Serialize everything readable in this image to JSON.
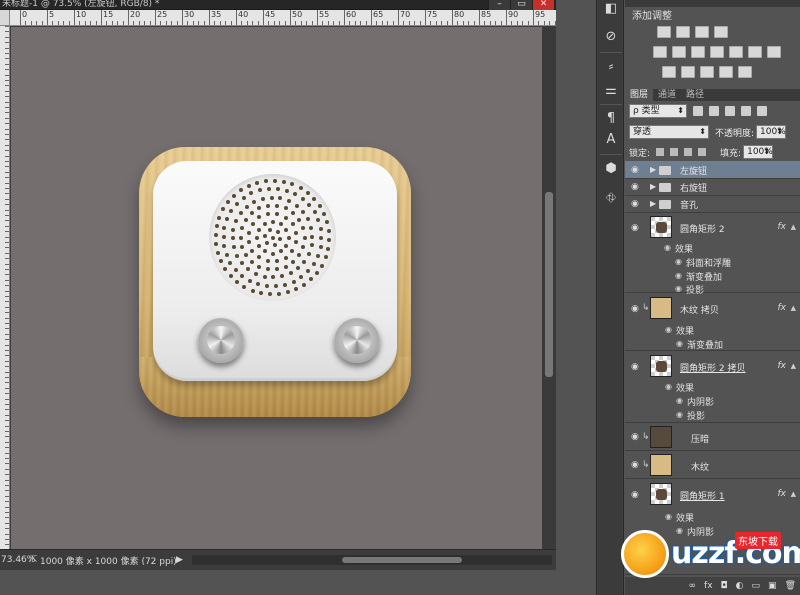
{
  "document": {
    "title": "未标题-1 @ 73.5% (左旋钮, RGB/8) *",
    "ruler_labels": [
      "0",
      "5",
      "10",
      "15",
      "20",
      "25",
      "30",
      "35",
      "40",
      "45",
      "50",
      "55",
      "60",
      "65",
      "70",
      "75",
      "80",
      "85",
      "90",
      "95"
    ],
    "window_buttons": [
      "–",
      "▭",
      "✕"
    ]
  },
  "status": {
    "zoom": "73.46%",
    "doc_size": "1000 像素 x 1000 像素 (72 ppi)",
    "arrow": "▶"
  },
  "adjustments": {
    "tabs_hidden": true,
    "title": "添加调整"
  },
  "layers_panel": {
    "tabs": [
      "图层",
      "通道",
      "路径"
    ],
    "filter_type": "ρ 类型",
    "blend_mode": "穿透",
    "opacity_label": "不透明度:",
    "opacity_value": "100%",
    "lock_label": "锁定:",
    "fill_label": "填充:",
    "fill_value": "100%",
    "layers": [
      {
        "name": "左旋钮",
        "kind": "group",
        "selected": true
      },
      {
        "name": "右旋钮",
        "kind": "group"
      },
      {
        "name": "音孔",
        "kind": "group"
      },
      {
        "name": "圆角矩形 2",
        "kind": "shape",
        "fx": "fx",
        "effects": [
          "效果",
          "斜面和浮雕",
          "渐变叠加",
          "投影"
        ]
      },
      {
        "name": "木纹 拷贝",
        "kind": "clip-wood",
        "fx": "fx",
        "effects": [
          "效果",
          "渐变叠加"
        ]
      },
      {
        "name": "圆角矩形 2 拷贝",
        "kind": "shape",
        "fx": "fx",
        "effects": [
          "效果",
          "内阴影",
          "投影"
        ]
      },
      {
        "name": "压暗",
        "kind": "clip-dark"
      },
      {
        "name": "木纹",
        "kind": "clip-wood"
      },
      {
        "name": "圆角矩形 1",
        "kind": "shape",
        "fx": "fx",
        "effects": [
          "效果",
          "内阴影"
        ]
      }
    ],
    "footer": [
      "∞",
      "fx",
      "◘",
      "◐",
      "▭",
      "▣",
      "🗑"
    ]
  },
  "watermark": {
    "text": "uzzf.com",
    "sub": "东坡下载"
  },
  "colors": {
    "canvas": "#746e6f",
    "selected_layer": "#6e7f92",
    "panel": "#535353"
  }
}
